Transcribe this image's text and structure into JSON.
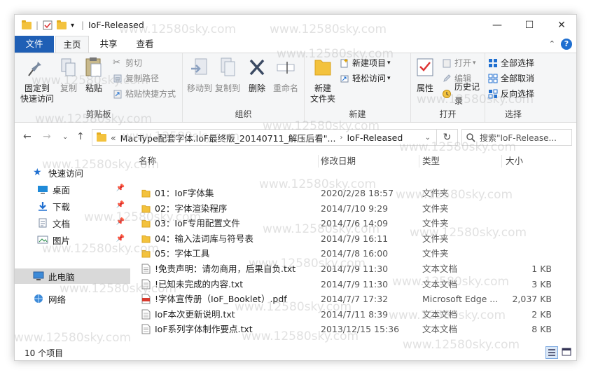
{
  "window": {
    "title": "IoF-Released",
    "controls": {
      "minimize": "—",
      "maximize": "☐",
      "close": "✕"
    }
  },
  "ribbon_tabs": {
    "file": "文件",
    "home": "主页",
    "share": "共享",
    "view": "查看"
  },
  "ribbon": {
    "clipboard": {
      "label": "剪贴板",
      "pin_line1": "固定到",
      "pin_line2": "快速访问",
      "copy": "复制",
      "paste": "粘贴",
      "cut": "剪切",
      "copy_path": "复制路径",
      "paste_shortcut": "粘贴快捷方式"
    },
    "organize": {
      "label": "组织",
      "move_to": "移动到",
      "copy_to": "复制到",
      "delete": "删除",
      "rename": "重命名"
    },
    "new": {
      "label": "新建",
      "new_folder_line1": "新建",
      "new_folder_line2": "文件夹",
      "new_item": "新建项目",
      "easy_access": "轻松访问"
    },
    "open": {
      "label": "打开",
      "properties": "属性",
      "open": "打开",
      "edit": "编辑",
      "history": "历史记录"
    },
    "select": {
      "label": "选择",
      "select_all": "全部选择",
      "select_none": "全部取消",
      "invert": "反向选择"
    }
  },
  "address_bar": {
    "overflow": "«",
    "path": [
      "MacType配套字体.IoF最终版_20140711_解压后看\"...",
      "IoF-Released"
    ],
    "search_placeholder": "搜索\"IoF-Release..."
  },
  "nav_pane": {
    "quick_access": "快速访问",
    "desktop": "桌面",
    "downloads": "下载",
    "documents": "文档",
    "pictures": "图片",
    "this_pc": "此电脑",
    "network": "网络"
  },
  "columns": {
    "name": "名称",
    "date": "修改日期",
    "type": "类型",
    "size": "大小"
  },
  "files": [
    {
      "name": "01：IoF字体集",
      "date": "2020/2/28 18:57",
      "type": "文件夹",
      "size": "",
      "kind": "folder"
    },
    {
      "name": "02：字体渲染程序",
      "date": "2014/7/10 9:29",
      "type": "文件夹",
      "size": "",
      "kind": "folder"
    },
    {
      "name": "03：IoF专用配置文件",
      "date": "2014/7/6 14:09",
      "type": "文件夹",
      "size": "",
      "kind": "folder"
    },
    {
      "name": "04：输入法词库与符号表",
      "date": "2014/7/9 16:11",
      "type": "文件夹",
      "size": "",
      "kind": "folder"
    },
    {
      "name": "05：字体工具",
      "date": "2014/7/8 16:00",
      "type": "文件夹",
      "size": "",
      "kind": "folder"
    },
    {
      "name": "!免责声明：请勿商用，后果自负.txt",
      "date": "2014/7/9 11:30",
      "type": "文本文档",
      "size": "1 KB",
      "kind": "txt"
    },
    {
      "name": "!已知未完成的内容.txt",
      "date": "2014/7/9 11:30",
      "type": "文本文档",
      "size": "3 KB",
      "kind": "txt"
    },
    {
      "name": "!字体宣传册（IoF_Booklet）.pdf",
      "date": "2014/7/7 17:32",
      "type": "Microsoft Edge ...",
      "size": "2,037 KB",
      "kind": "pdf"
    },
    {
      "name": "IoF本次更新说明.txt",
      "date": "2014/7/11 8:39",
      "type": "文本文档",
      "size": "2 KB",
      "kind": "txt"
    },
    {
      "name": "IoF系列字体制作要点.txt",
      "date": "2013/12/15 15:36",
      "type": "文本文档",
      "size": "8 KB",
      "kind": "txt"
    }
  ],
  "status": {
    "count": "10 个项目"
  },
  "watermark": "www.12580sky.com",
  "colors": {
    "file_tab": "#1f5fb5",
    "folder": "#f3c23d",
    "selection": "#d9d9d9",
    "pdf": "#d83b2f",
    "accent_blue": "#1f6fd0"
  }
}
